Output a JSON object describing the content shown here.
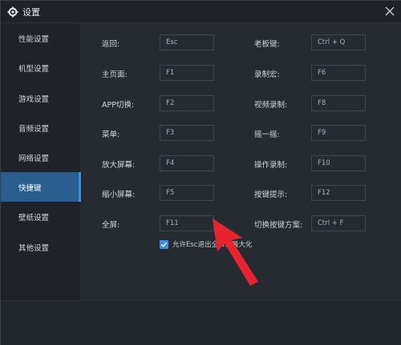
{
  "window": {
    "title": "设置"
  },
  "sidebar": {
    "items": [
      {
        "label": "性能设置",
        "active": false
      },
      {
        "label": "机型设置",
        "active": false
      },
      {
        "label": "游戏设置",
        "active": false
      },
      {
        "label": "音频设置",
        "active": false
      },
      {
        "label": "网络设置",
        "active": false
      },
      {
        "label": "快捷键",
        "active": true
      },
      {
        "label": "壁纸设置",
        "active": false
      },
      {
        "label": "其他设置",
        "active": false
      }
    ]
  },
  "shortcuts": {
    "left": [
      {
        "label": "返回:",
        "key": "Esc"
      },
      {
        "label": "主页面:",
        "key": "F1"
      },
      {
        "label": "APP切换:",
        "key": "F2"
      },
      {
        "label": "菜单:",
        "key": "F3"
      },
      {
        "label": "放大屏幕:",
        "key": "F4"
      },
      {
        "label": "缩小屏幕:",
        "key": "F5"
      },
      {
        "label": "全屏:",
        "key": "F11"
      }
    ],
    "right": [
      {
        "label": "老板键:",
        "key": "Ctrl + Q"
      },
      {
        "label": "录制宏:",
        "key": "F6"
      },
      {
        "label": "视频录制:",
        "key": "F8"
      },
      {
        "label": "摇一摇:",
        "key": "F9"
      },
      {
        "label": "操作录制:",
        "key": "F10"
      },
      {
        "label": "按键提示:",
        "key": "F12"
      },
      {
        "label": "切换按键方案:",
        "key": "Ctrl + F"
      }
    ]
  },
  "fullscreen_option": {
    "label": "允许Esc退出全屏或最大化",
    "checked": true
  },
  "colors": {
    "accent": "#3d8ee0",
    "active_item_bg": "#2a5e8e",
    "annotation_arrow": "#e8232f"
  }
}
